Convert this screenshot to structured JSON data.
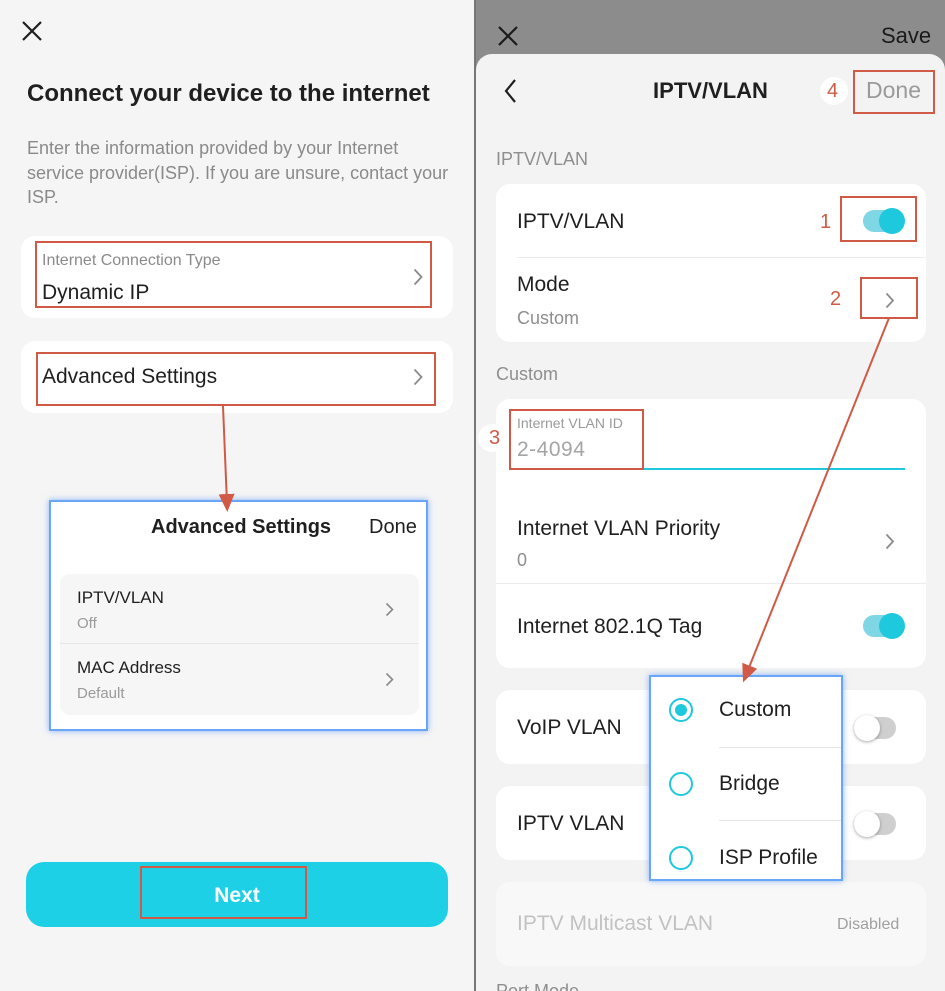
{
  "left": {
    "close_icon": "close-icon",
    "title": "Connect your device to the internet",
    "description": "Enter the information provided by your Internet service provider(ISP). If you are unsure, contact your ISP.",
    "connection_type": {
      "label": "Internet Connection Type",
      "value": "Dynamic IP"
    },
    "advanced_settings": {
      "label": "Advanced Settings"
    },
    "next_button": "Next",
    "accent_color": "#1ed0e6"
  },
  "advanced_popup": {
    "title": "Advanced Settings",
    "done": "Done",
    "items": [
      {
        "label": "IPTV/VLAN",
        "value": "Off"
      },
      {
        "label": "MAC Address",
        "value": "Default"
      }
    ]
  },
  "right": {
    "save": "Save",
    "header": {
      "title": "IPTV/VLAN",
      "done": "Done",
      "callout": "4"
    },
    "section_iptv": "IPTV/VLAN",
    "iptv_vlan_row": {
      "label": "IPTV/VLAN",
      "toggle": "on",
      "callout": "1"
    },
    "mode_row": {
      "label": "Mode",
      "value": "Custom",
      "callout": "2"
    },
    "section_custom": "Custom",
    "vlan_id": {
      "label": "Internet VLAN ID",
      "placeholder": "2-4094",
      "callout": "3"
    },
    "vlan_priority": {
      "label": "Internet VLAN Priority",
      "value": "0"
    },
    "tag_row": {
      "label": "Internet 802.1Q Tag",
      "toggle": "on"
    },
    "voip_vlan": {
      "label": "VoIP VLAN",
      "toggle": "off"
    },
    "iptv_vlan": {
      "label": "IPTV VLAN",
      "toggle": "off"
    },
    "multicast": {
      "label": "IPTV Multicast VLAN",
      "value": "Disabled"
    },
    "cut_off_label": "Port Mode"
  },
  "mode_popup": {
    "options": [
      {
        "label": "Custom",
        "selected": true
      },
      {
        "label": "Bridge",
        "selected": false
      },
      {
        "label": "ISP Profile",
        "selected": false
      }
    ]
  },
  "colors": {
    "highlight_red": "#d05a45",
    "popup_border_blue": "#6aa6f7",
    "toggle_teal": "#1ec8dd"
  }
}
